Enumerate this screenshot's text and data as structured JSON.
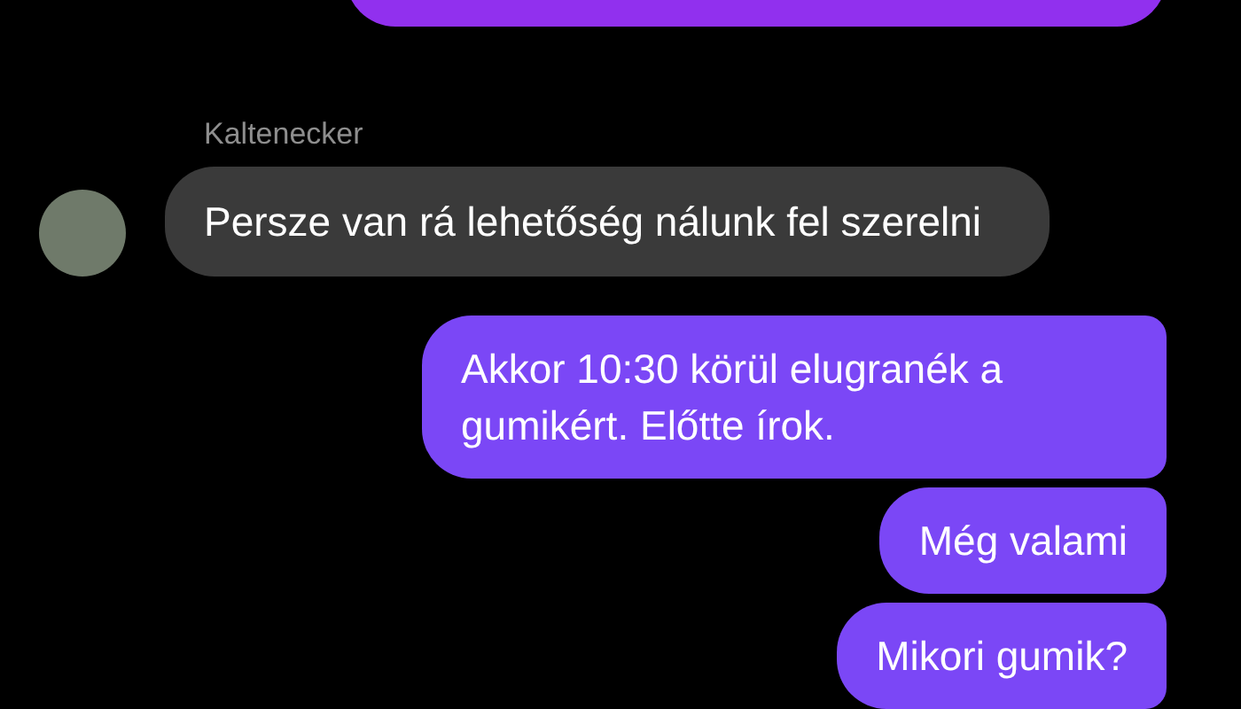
{
  "messages": [
    {
      "kind": "outgoing_cut"
    },
    {
      "kind": "sender",
      "text": "Kaltenecker"
    },
    {
      "kind": "incoming",
      "text": "Persze van rá lehetőség nálunk fel szerelni"
    },
    {
      "kind": "outgoing",
      "text": "Akkor 10:30 körül elugranék a gumikért. Előtte írok."
    },
    {
      "kind": "outgoing",
      "text": "Még valami"
    },
    {
      "kind": "outgoing",
      "text": "Mikori gumik?"
    }
  ]
}
